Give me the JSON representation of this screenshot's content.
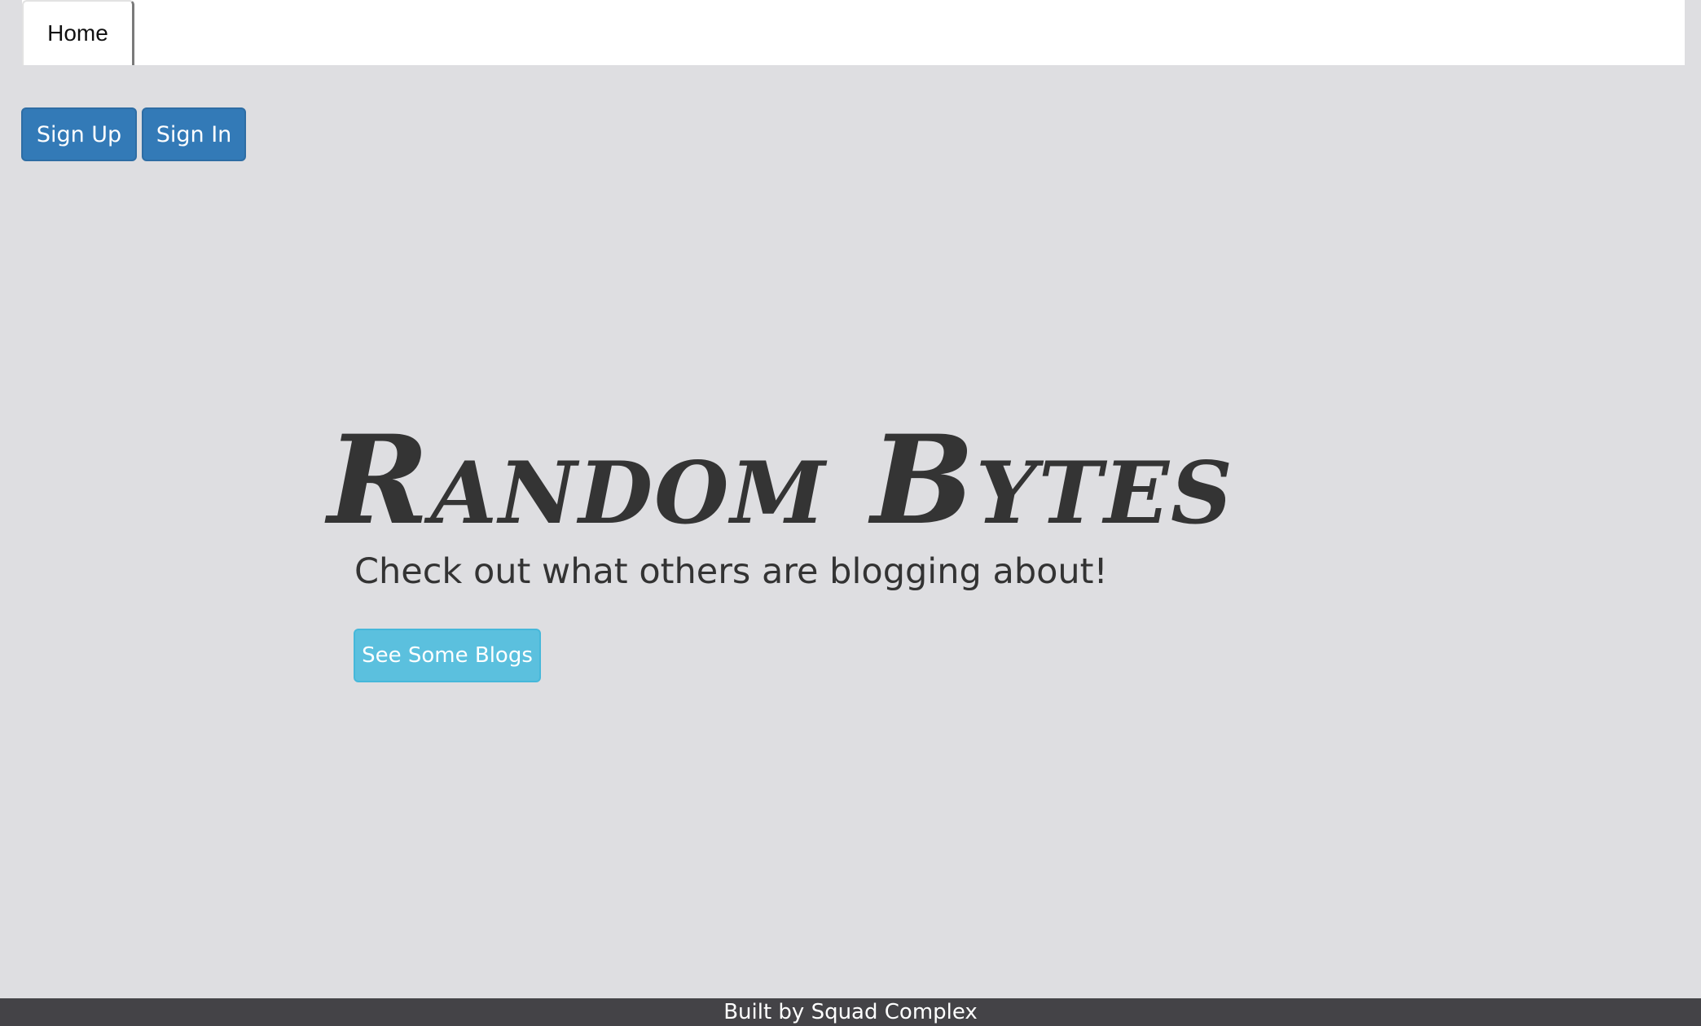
{
  "nav": {
    "tabs": [
      {
        "label": "Home"
      }
    ]
  },
  "auth": {
    "sign_up_label": "Sign Up",
    "sign_in_label": "Sign In"
  },
  "hero": {
    "title": "Random Bytes",
    "subtitle": "Check out what others are blogging about!",
    "cta_label": "See Some Blogs"
  },
  "footer": {
    "text": "Built by Squad Complex"
  },
  "colors": {
    "background": "#dedee1",
    "primary_button": "#337ab7",
    "info_button": "#5bc0de",
    "footer": "#444347",
    "title_text": "#343434"
  }
}
